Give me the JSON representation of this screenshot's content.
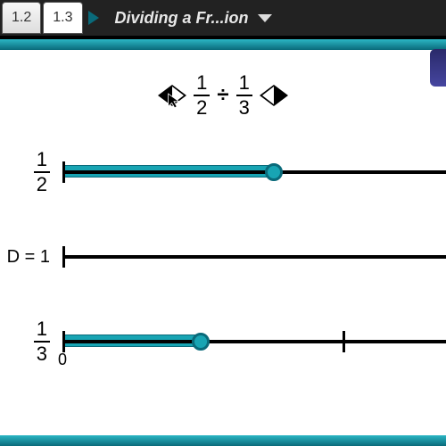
{
  "header": {
    "tabs": [
      "1.2",
      "1.3"
    ],
    "active_tab_index": 1,
    "title": "Dividing a Fr...ion"
  },
  "expression": {
    "left": {
      "num": "1",
      "den": "2"
    },
    "op": "÷",
    "right": {
      "num": "1",
      "den": "3"
    }
  },
  "lines": [
    {
      "label_type": "frac",
      "num": "1",
      "den": "2",
      "fill_percent": 55,
      "knob_percent": 55,
      "ticks": [],
      "show_zero": false
    },
    {
      "label_type": "text",
      "text": "D = 1",
      "fill_percent": 0,
      "knob_percent": null,
      "ticks": [],
      "show_zero": false
    },
    {
      "label_type": "frac",
      "num": "1",
      "den": "3",
      "fill_percent": 36,
      "knob_percent": 36,
      "ticks": [
        73
      ],
      "show_zero": true,
      "zero": "0"
    }
  ]
}
